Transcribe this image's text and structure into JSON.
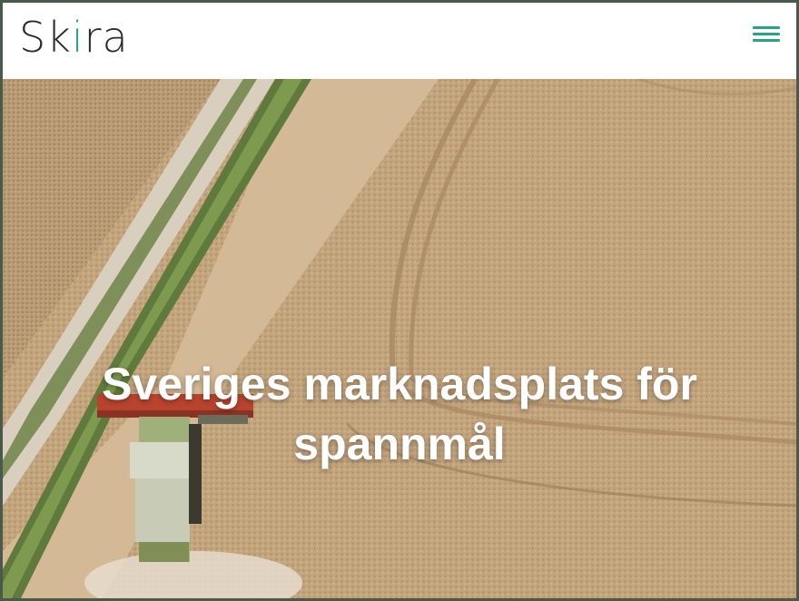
{
  "header": {
    "logo_text_start": "Sk",
    "logo_text_leaf": "i",
    "logo_text_end": "ra",
    "menu_icon": "hamburger-menu-icon",
    "accent_color": "#27a583"
  },
  "hero": {
    "title": "Sveriges marknadsplats för spannmål",
    "image": "aerial-wheat-field-combine-harvester"
  }
}
